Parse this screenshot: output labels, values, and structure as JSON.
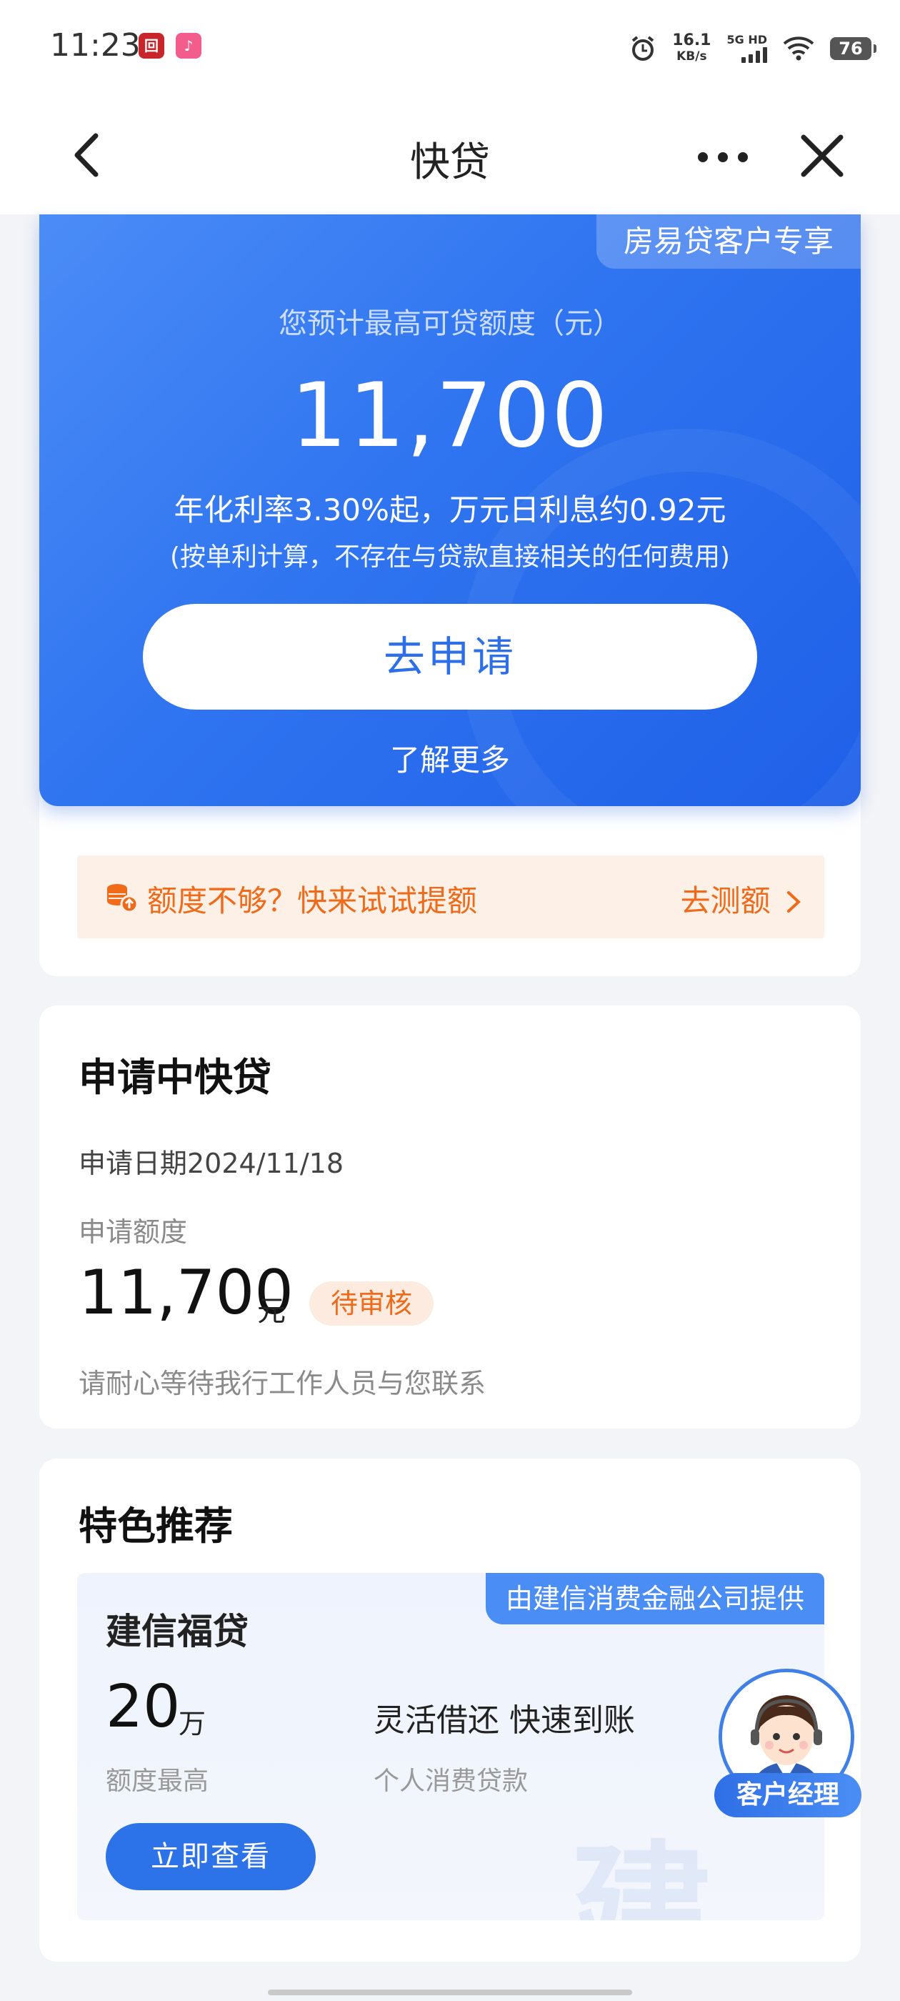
{
  "status_bar": {
    "time": "11:23",
    "net_speed_value": "16.1",
    "net_speed_unit": "KB/s",
    "signal_label": "5G HD",
    "battery": "76"
  },
  "nav": {
    "title": "快贷"
  },
  "hero": {
    "tag": "房易贷客户专享",
    "subtitle": "您预计最高可贷额度（元）",
    "amount": "11,700",
    "rate": "年化利率3.30%起，万元日利息约0.92元",
    "note": "(按单利计算，不存在与贷款直接相关的任何费用)",
    "apply_label": "去申请",
    "learn_more": "了解更多"
  },
  "tip": {
    "text": "额度不够？快来试试提额",
    "link": "去测额"
  },
  "application": {
    "title": "申请中快贷",
    "date": "申请日期2024/11/18",
    "amount_label": "申请额度",
    "amount": "11,700",
    "unit": "元",
    "status": "待审核",
    "hint": "请耐心等待我行工作人员与您联系"
  },
  "recommend": {
    "title": "特色推荐",
    "provider": "由建信消费金融公司提供",
    "product_name": "建信福贷",
    "quota_value": "20",
    "quota_unit": "万",
    "quota_label": "额度最高",
    "feature": "灵活借还 快速到账",
    "feature_sub": "个人消费贷款",
    "button": "立即查看"
  },
  "customer_manager": {
    "label": "客户经理"
  },
  "colors": {
    "primary": "#2f74f0",
    "accent_orange": "#f06a1a"
  }
}
